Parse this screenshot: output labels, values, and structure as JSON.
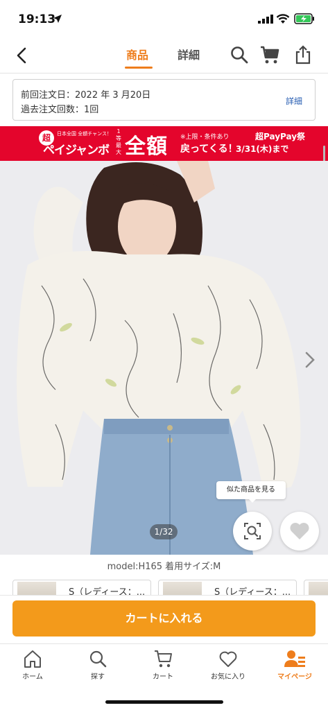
{
  "status_bar": {
    "time": "19:13",
    "icons": [
      "location-arrow-icon",
      "signal-icon",
      "wifi-icon",
      "battery-charging-icon"
    ]
  },
  "nav": {
    "tabs": [
      {
        "label": "商品",
        "active": true
      },
      {
        "label": "詳細",
        "active": false
      }
    ],
    "icons": [
      "back-chevron-icon",
      "search-icon",
      "cart-icon",
      "share-icon"
    ],
    "accent_color": "#ee7d1c"
  },
  "order_info": {
    "last_order": "前回注文日：2022 年 3 月20日",
    "past_count": "過去注文回数：1回",
    "detail_link": "詳細"
  },
  "banner": {
    "badge": "超",
    "small_text": "日本全国 全額チャンス！",
    "title": "ペイジャンボ",
    "rank_text": "1等最大",
    "big_text": "全額",
    "note": "※上限・条件あり",
    "headline": "戻ってくる！",
    "fest": "超PayPay祭",
    "deadline": "3/31(木)まで",
    "color": "#e4052c"
  },
  "product_image": {
    "counter": "1/32",
    "similar_button": "似た商品を見る",
    "icons": [
      "next-chevron-icon",
      "visual-search-icon",
      "heart-icon"
    ]
  },
  "model_info": "model:H165 着用サイズ:M",
  "variants": [
    {
      "label": "S（レディース：..."
    },
    {
      "label": "S（レディース：..."
    }
  ],
  "cart_button": {
    "label": "カートに入れる",
    "color": "#f39a1b"
  },
  "tabbar": {
    "items": [
      {
        "label": "ホーム",
        "icon": "home-icon",
        "active": false
      },
      {
        "label": "探す",
        "icon": "search-icon",
        "active": false
      },
      {
        "label": "カート",
        "icon": "cart-icon",
        "active": false
      },
      {
        "label": "お気に入り",
        "icon": "heart-icon",
        "active": false
      },
      {
        "label": "マイページ",
        "icon": "user-icon",
        "active": true
      }
    ]
  }
}
